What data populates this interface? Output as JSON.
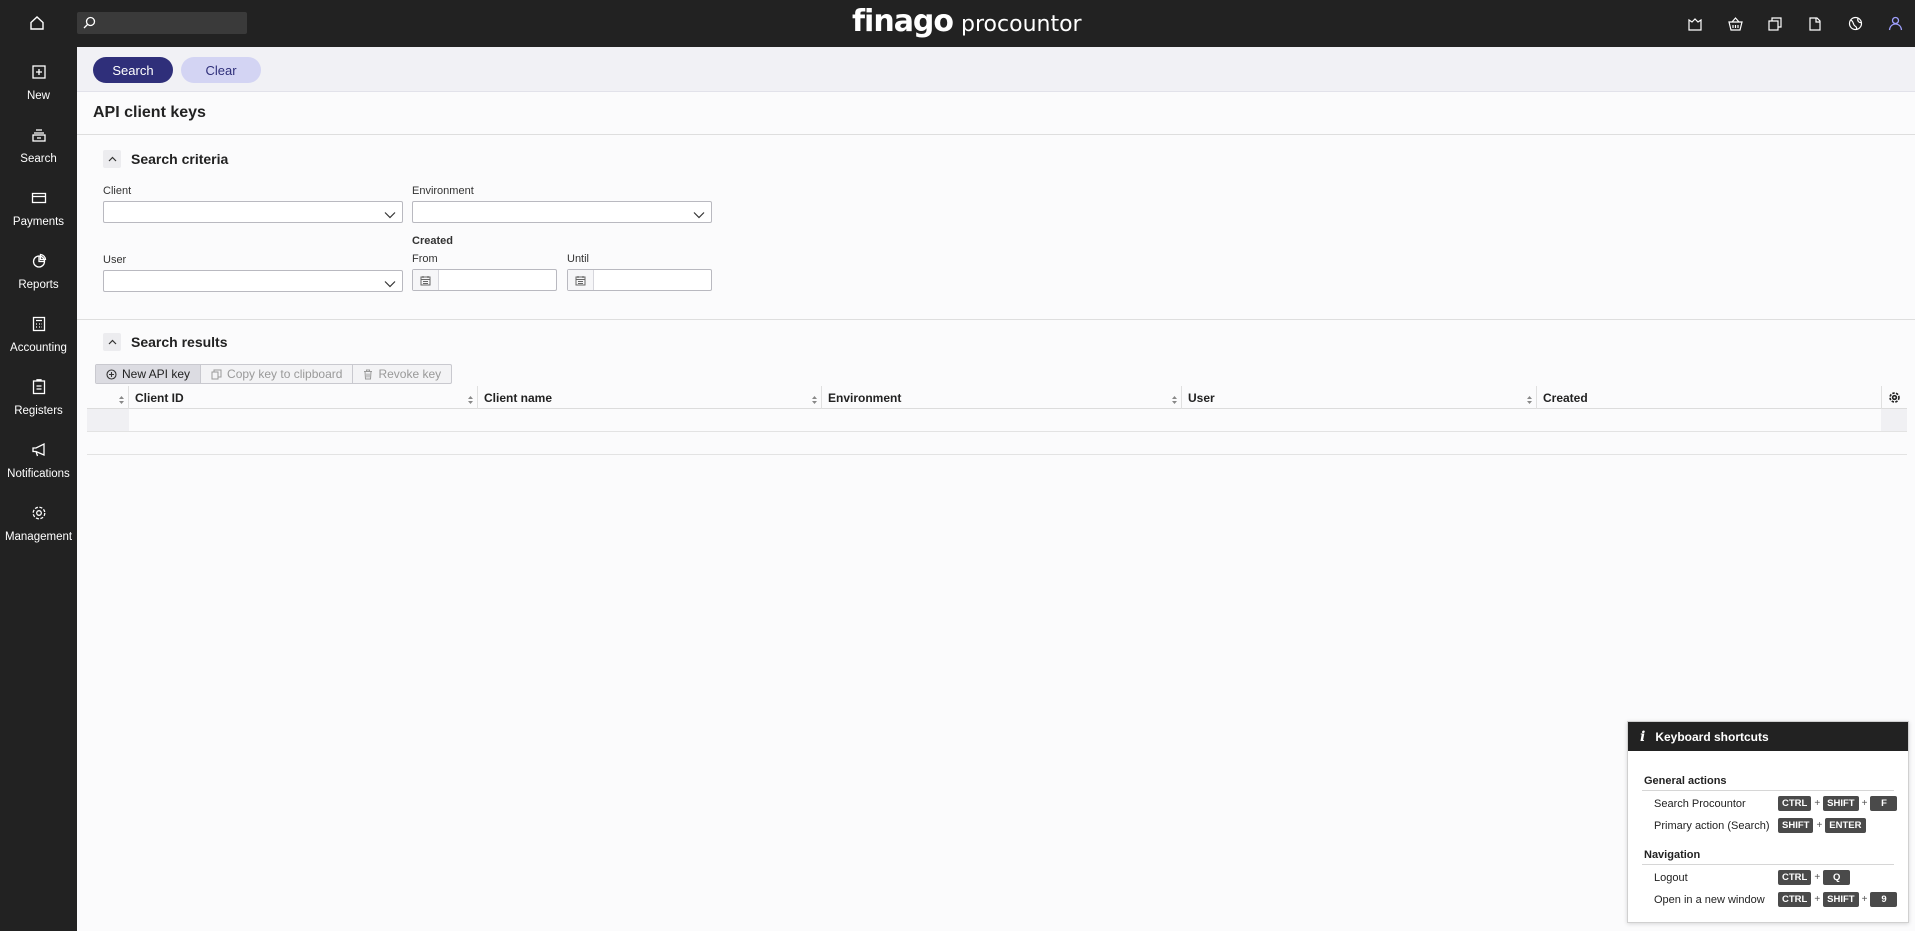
{
  "brand": {
    "name_part1": "finago",
    "name_part2": "procountor"
  },
  "sidebar": {
    "items": [
      {
        "label": "New",
        "icon": "new-document-icon"
      },
      {
        "label": "Search",
        "icon": "stack-icon"
      },
      {
        "label": "Payments",
        "icon": "card-icon"
      },
      {
        "label": "Reports",
        "icon": "pie-chart-icon"
      },
      {
        "label": "Accounting",
        "icon": "calculator-icon"
      },
      {
        "label": "Registers",
        "icon": "register-icon"
      },
      {
        "label": "Notifications",
        "icon": "megaphone-icon"
      },
      {
        "label": "Management",
        "icon": "gear-icon"
      }
    ]
  },
  "toolbar": {
    "search_label": "Search",
    "clear_label": "Clear"
  },
  "page": {
    "title": "API client keys"
  },
  "criteria": {
    "title": "Search criteria",
    "client_label": "Client",
    "environment_label": "Environment",
    "user_label": "User",
    "created_label": "Created",
    "from_label": "From",
    "until_label": "Until"
  },
  "results": {
    "title": "Search results",
    "new_key_label": "New API key",
    "copy_key_label": "Copy key to clipboard",
    "revoke_key_label": "Revoke key",
    "columns": [
      "Client ID",
      "Client name",
      "Environment",
      "User",
      "Created"
    ]
  },
  "shortcuts": {
    "title": "Keyboard shortcuts",
    "general_title": "General actions",
    "navigation_title": "Navigation",
    "rows": [
      {
        "label": "Search Procountor",
        "keys": [
          "CTRL",
          "SHIFT",
          "F"
        ]
      },
      {
        "label": "Primary action (Search)",
        "keys": [
          "SHIFT",
          "ENTER"
        ]
      },
      {
        "label": "Logout",
        "keys": [
          "CTRL",
          "Q"
        ]
      },
      {
        "label": "Open in a new window",
        "keys": [
          "CTRL",
          "SHIFT",
          "9"
        ]
      }
    ]
  },
  "colors": {
    "primary": "#2f2f7a",
    "secondary": "#d3d4f3",
    "chrome": "#222222"
  }
}
